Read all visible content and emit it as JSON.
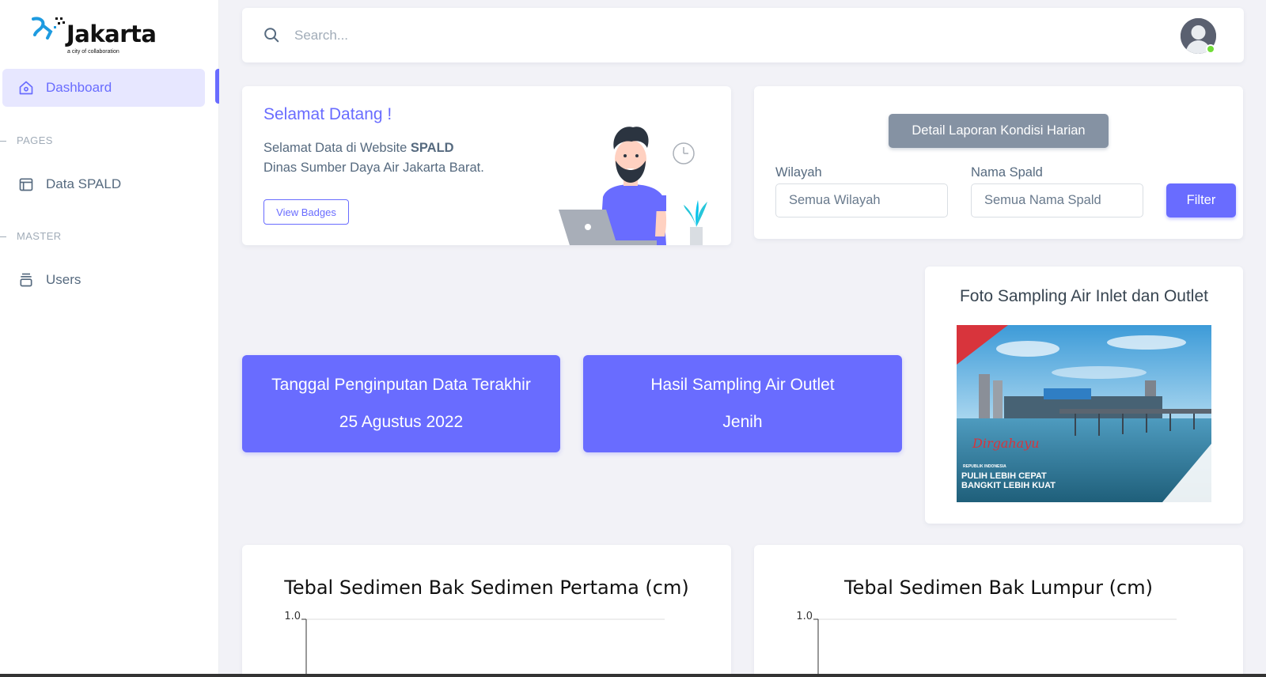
{
  "logo": {
    "text": "Jakarta",
    "tagline": "a city of collaboration"
  },
  "sidebar": {
    "dashboard_label": "Dashboard",
    "pages_header": "PAGES",
    "data_spald_label": "Data SPALD",
    "master_header": "MASTER",
    "users_label": "Users"
  },
  "search": {
    "placeholder": "Search..."
  },
  "welcome": {
    "title": "Selamat Datang !",
    "line1_prefix": "Selamat Data di Website ",
    "line1_bold": "SPALD",
    "line2": "Dinas Sumber Daya Air Jakarta Barat.",
    "button_label": "View Badges"
  },
  "filter": {
    "detail_button": "Detail Laporan Kondisi Harian",
    "wilayah_label": "Wilayah",
    "wilayah_value": "Semua Wilayah",
    "nama_label": "Nama Spald",
    "nama_value": "Semua Nama Spald",
    "filter_button": "Filter"
  },
  "stats": [
    {
      "title": "Tanggal Penginputan Data Terakhir",
      "value": "25 Agustus 2022"
    },
    {
      "title": "Hasil Sampling Air Outlet",
      "value": "Jenih"
    }
  ],
  "photo": {
    "title": "Foto Sampling Air Inlet dan Outlet",
    "overlay_line1": "PULIH LEBIH CEPAT",
    "overlay_line2": "BANGKIT LEBIH KUAT",
    "overlay_small": "REPUBLIK INDONESIA",
    "overlay_script": "Dirgahayu"
  },
  "colors": {
    "primary": "#696cff",
    "secondary": "#8592a3",
    "online": "#71dd37"
  },
  "chart_data": [
    {
      "type": "line",
      "title": "Tebal Sedimen Bak Sedimen Pertama (cm)",
      "yticks": [
        "1.0"
      ],
      "ylim": [
        null,
        1.0
      ],
      "series": []
    },
    {
      "type": "line",
      "title": "Tebal Sedimen Bak Lumpur (cm)",
      "yticks": [
        "1.0"
      ],
      "ylim": [
        null,
        1.0
      ],
      "series": []
    }
  ]
}
